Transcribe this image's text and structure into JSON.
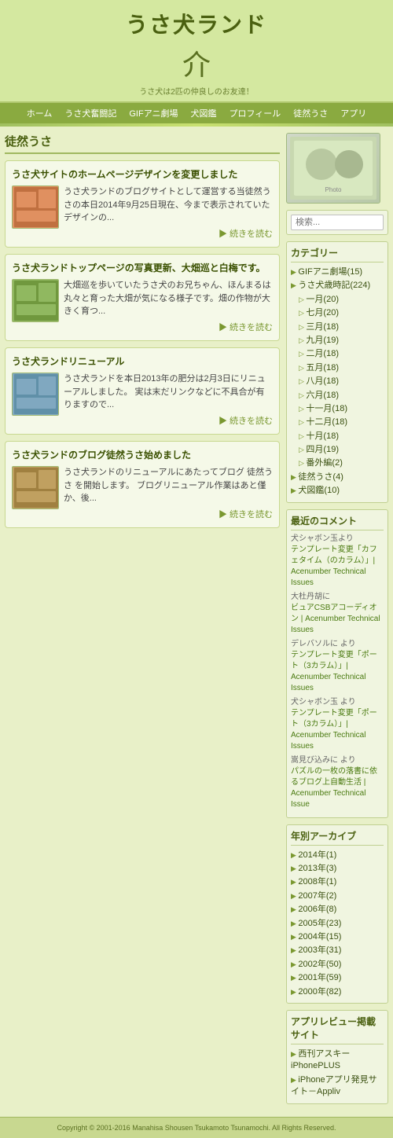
{
  "header": {
    "site_title": "うさ犬ランド",
    "site_subtitle": "うさ犬は2匹の仲良しのお友達！",
    "icon": "介"
  },
  "nav": {
    "items": [
      {
        "label": "ホーム",
        "id": "home"
      },
      {
        "label": "うさ犬奮闘記",
        "id": "usaken"
      },
      {
        "label": "GIFアニ劇場",
        "id": "gif"
      },
      {
        "label": "犬図鑑",
        "id": "dogs"
      },
      {
        "label": "プロフィール",
        "id": "profile"
      },
      {
        "label": "徒然うさ",
        "id": "tsurezure"
      },
      {
        "label": "アプリ",
        "id": "app"
      }
    ]
  },
  "page": {
    "title": "徒然うさ"
  },
  "posts": [
    {
      "id": "post1",
      "title": "うさ犬サイトのホームページデザインを変更しました",
      "text": "うさ犬ランドのブログサイトとして運営する当徒然うさの本日2014年9月25日現在、今まで表示されていたデザインの...",
      "read_more": "▶ 続きを読む",
      "thumb_type": "image1"
    },
    {
      "id": "post2",
      "title": "うさ犬ランドトップページの写真更新、大畑巡と白梅です。",
      "text": "大畑巡を歩いていたうさ犬のお兄ちゃん、ほんまるは丸々と育った大畑が気になる様子です。畑の作物が大きく育つ...",
      "read_more": "▶ 続きを読む",
      "thumb_type": "image2"
    },
    {
      "id": "post3",
      "title": "うさ犬ランドリニューアル",
      "text": "うさ犬ランドを本日2013年の肥分は2月3日にリニューアルしました。 実は末だリンクなどに不具合が有りますので...",
      "read_more": "▶ 続きを読む",
      "thumb_type": "image3"
    },
    {
      "id": "post4",
      "title": "うさ犬ランドのブログ徒然うさ始めました",
      "text": "うさ犬ランドのリニューアルにあたってブログ 徒然うさ を開始します。 ブログリニューアル作業はあと僅か、後...",
      "read_more": "▶ 続きを読む",
      "thumb_type": "image4"
    }
  ],
  "sidebar": {
    "search_placeholder": "検索...",
    "categories_title": "カテゴリー",
    "categories": [
      {
        "label": "GIFアニ劇場(15)",
        "indent": false
      },
      {
        "label": "うさ犬歳時記(224)",
        "indent": false
      },
      {
        "label": "一月(20)",
        "indent": true
      },
      {
        "label": "七月(20)",
        "indent": true
      },
      {
        "label": "三月(18)",
        "indent": true
      },
      {
        "label": "九月(19)",
        "indent": true
      },
      {
        "label": "二月(18)",
        "indent": true
      },
      {
        "label": "五月(18)",
        "indent": true
      },
      {
        "label": "八月(18)",
        "indent": true
      },
      {
        "label": "六月(18)",
        "indent": true
      },
      {
        "label": "十一月(18)",
        "indent": true
      },
      {
        "label": "十二月(18)",
        "indent": true
      },
      {
        "label": "十月(18)",
        "indent": true
      },
      {
        "label": "四月(19)",
        "indent": true
      },
      {
        "label": "番外編(2)",
        "indent": true
      },
      {
        "label": "徒然うさ(4)",
        "indent": false
      },
      {
        "label": "犬図鑑(10)",
        "indent": false
      }
    ],
    "recent_comments_title": "最近のコメント",
    "recent_comments": [
      {
        "author": "犬シャボン玉より",
        "text": "テンプレート変更「カフェタイム（のカラム）」| Acenumber Technical Issues"
      },
      {
        "author": "大杜丹胡に",
        "text": "ビュアCSBアコーディオン | Acenumber Technical Issues"
      },
      {
        "author": "デレバソルに より",
        "text": "テンプレート変更「ポート（3カラム）」| Acenumber Technical Issues"
      },
      {
        "author": "犬シャボン玉 より",
        "text": "テンプレート変更「ポート（3カラム）」| Acenumber Technical Issues"
      },
      {
        "author": "嵩見び込みに より",
        "text": "パズルの一枚の落書に依るブログ上自動生活 | Acenumber Technical Issue"
      }
    ],
    "archives_title": "年別アーカイブ",
    "archives": [
      {
        "label": "2014年(1)"
      },
      {
        "label": "2013年(3)"
      },
      {
        "label": "2008年(1)"
      },
      {
        "label": "2007年(2)"
      },
      {
        "label": "2006年(8)"
      },
      {
        "label": "2005年(23)"
      },
      {
        "label": "2004年(15)"
      },
      {
        "label": "2003年(31)"
      },
      {
        "label": "2002年(50)"
      },
      {
        "label": "2001年(59)"
      },
      {
        "label": "2000年(82)"
      }
    ],
    "app_title": "アプリレビュー掲載サイト",
    "app_items": [
      {
        "label": "西刊アスキーiPhonePLUS"
      },
      {
        "label": "iPhoneアプリ発見サイト－Appliv"
      }
    ]
  },
  "footer": {
    "copyright": "Copyright © 2001-2016 Manahisa Shousen Tsukamoto Tsunamochi. All Rights Reserved."
  }
}
